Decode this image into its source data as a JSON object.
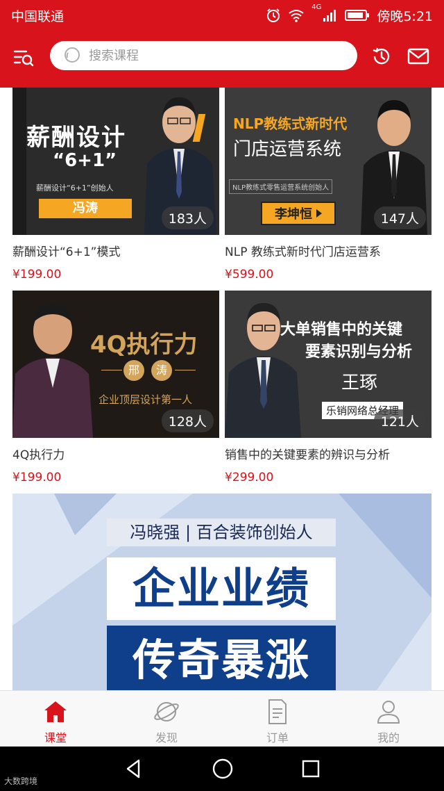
{
  "status_bar": {
    "carrier": "中国联通",
    "network": "4G",
    "time": "傍晚5:21"
  },
  "search": {
    "placeholder": "搜索课程"
  },
  "courses": [
    {
      "title": "薪酬设计“6+1”模式",
      "price": "¥199.00",
      "count": "183人",
      "poster": {
        "line1": "薪酬设计",
        "line2": "“6+1”",
        "sub": "薪酬设计“6+1”创始人",
        "name": "冯涛"
      }
    },
    {
      "title": "NLP 教练式新时代门店运营系",
      "price": "¥599.00",
      "count": "147人",
      "poster": {
        "line1": "NLP教练式新时代",
        "line2": "门店运营系统",
        "sub": "NLP教练式零售运营系统创始人",
        "name": "李坤恒"
      }
    },
    {
      "title": "4Q执行力",
      "price": "¥199.00",
      "count": "128人",
      "poster": {
        "line1": "4Q执行力",
        "name_a": "邢",
        "name_b": "涛",
        "sub": "企业顶层设计第一人"
      }
    },
    {
      "title": "销售中的关键要素的辨识与分析",
      "price": "¥299.00",
      "count": "121人",
      "poster": {
        "line1": "大单销售中的关键",
        "line2": "要素识别与分析",
        "name": "王琢",
        "sub": "乐销网络总经理"
      }
    }
  ],
  "banner": {
    "tag": "冯晓强 | 百合装饰创始人",
    "line1": "企业业绩",
    "line2": "传奇暴涨"
  },
  "tabs": [
    {
      "label": "课堂",
      "icon": "home-icon",
      "active": true
    },
    {
      "label": "发现",
      "icon": "planet-icon",
      "active": false
    },
    {
      "label": "订单",
      "icon": "order-icon",
      "active": false
    },
    {
      "label": "我的",
      "icon": "user-icon",
      "active": false
    }
  ],
  "watermark": "大数跨境",
  "colors": {
    "brand_red": "#d9131b",
    "price_red": "#d9131b",
    "poster_orange": "#f5a623"
  }
}
